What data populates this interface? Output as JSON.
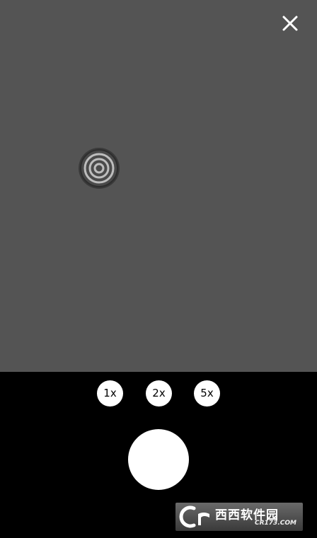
{
  "icons": {
    "close": "close-icon",
    "focus": "focus-target-icon"
  },
  "zoom": {
    "options": [
      "1x",
      "2x",
      "5x"
    ]
  },
  "watermark": {
    "main": "西西软件园",
    "sub": "CR173.COM"
  },
  "colors": {
    "viewfinder": "#545454",
    "controls_bg": "#000000",
    "button": "#ffffff",
    "watermark_accent": "#ff6a00"
  }
}
